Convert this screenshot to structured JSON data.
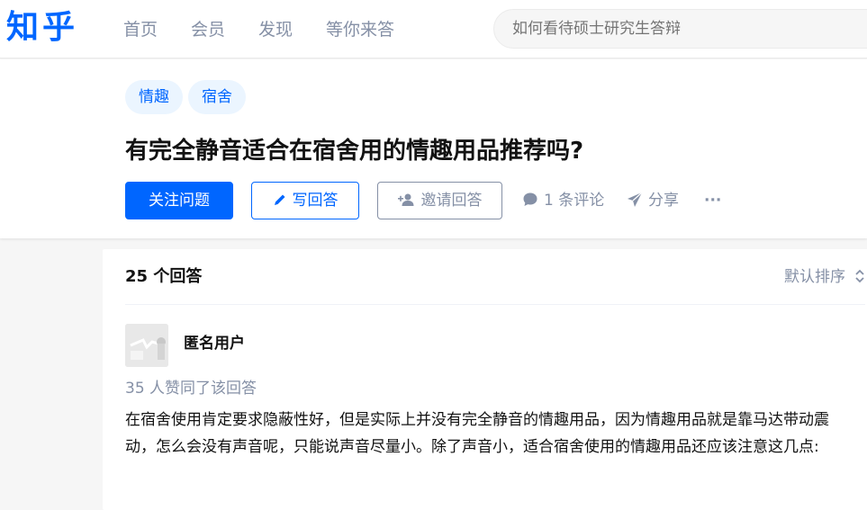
{
  "brand": {
    "logo": "知乎",
    "color": "#0066ff"
  },
  "nav": {
    "items": [
      "首页",
      "会员",
      "发现",
      "等你来答"
    ]
  },
  "search": {
    "placeholder": "如何看待硕士研究生答辩"
  },
  "question": {
    "tags": [
      "情趣",
      "宿舍"
    ],
    "title": "有完全静音适合在宿舍用的情趣用品推荐吗?",
    "follow_label": "关注问题",
    "write_label": "写回答",
    "invite_label": "邀请回答",
    "comments_label": "1 条评论",
    "share_label": "分享",
    "more_label": "···"
  },
  "answers": {
    "count_label": "25 个回答",
    "sort_label": "默认排序",
    "first": {
      "author": "匿名用户",
      "votes_label": "35 人赞同了该回答",
      "excerpt": "在宿舍使用肯定要求隐蔽性好，但是实际上并没有完全静音的情趣用品，因为情趣用品就是靠马达带动震动，怎么会没有声音呢，只能说声音尽量小。除了声音小，适合宿舍使用的情趣用品还应该注意这几点:"
    }
  },
  "icons": {
    "write": "pencil-icon",
    "invite": "add-user-icon",
    "comment": "comment-bubble-icon",
    "share": "paper-plane-icon",
    "sort": "sort-arrows-icon",
    "more": "more-dots-icon"
  }
}
